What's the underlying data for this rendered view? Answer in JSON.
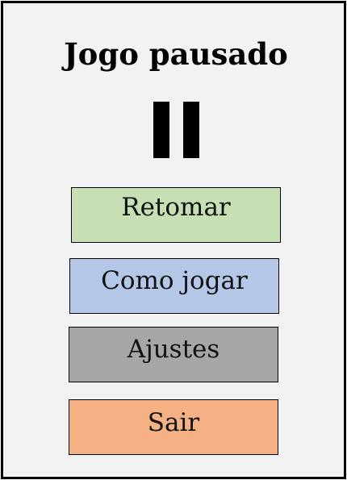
{
  "title": "Jogo pausado",
  "pause_icon": "pause-icon",
  "menu": {
    "resume": {
      "label": "Retomar",
      "color": "#c6e0b4"
    },
    "how_to_play": {
      "label": "Como jogar",
      "color": "#b4c7e7"
    },
    "settings": {
      "label": "Ajustes",
      "color": "#a6a6a6"
    },
    "exit": {
      "label": "Sair",
      "color": "#f4b183"
    }
  },
  "colors": {
    "background": "#f2f2f2",
    "border": "#000000"
  }
}
